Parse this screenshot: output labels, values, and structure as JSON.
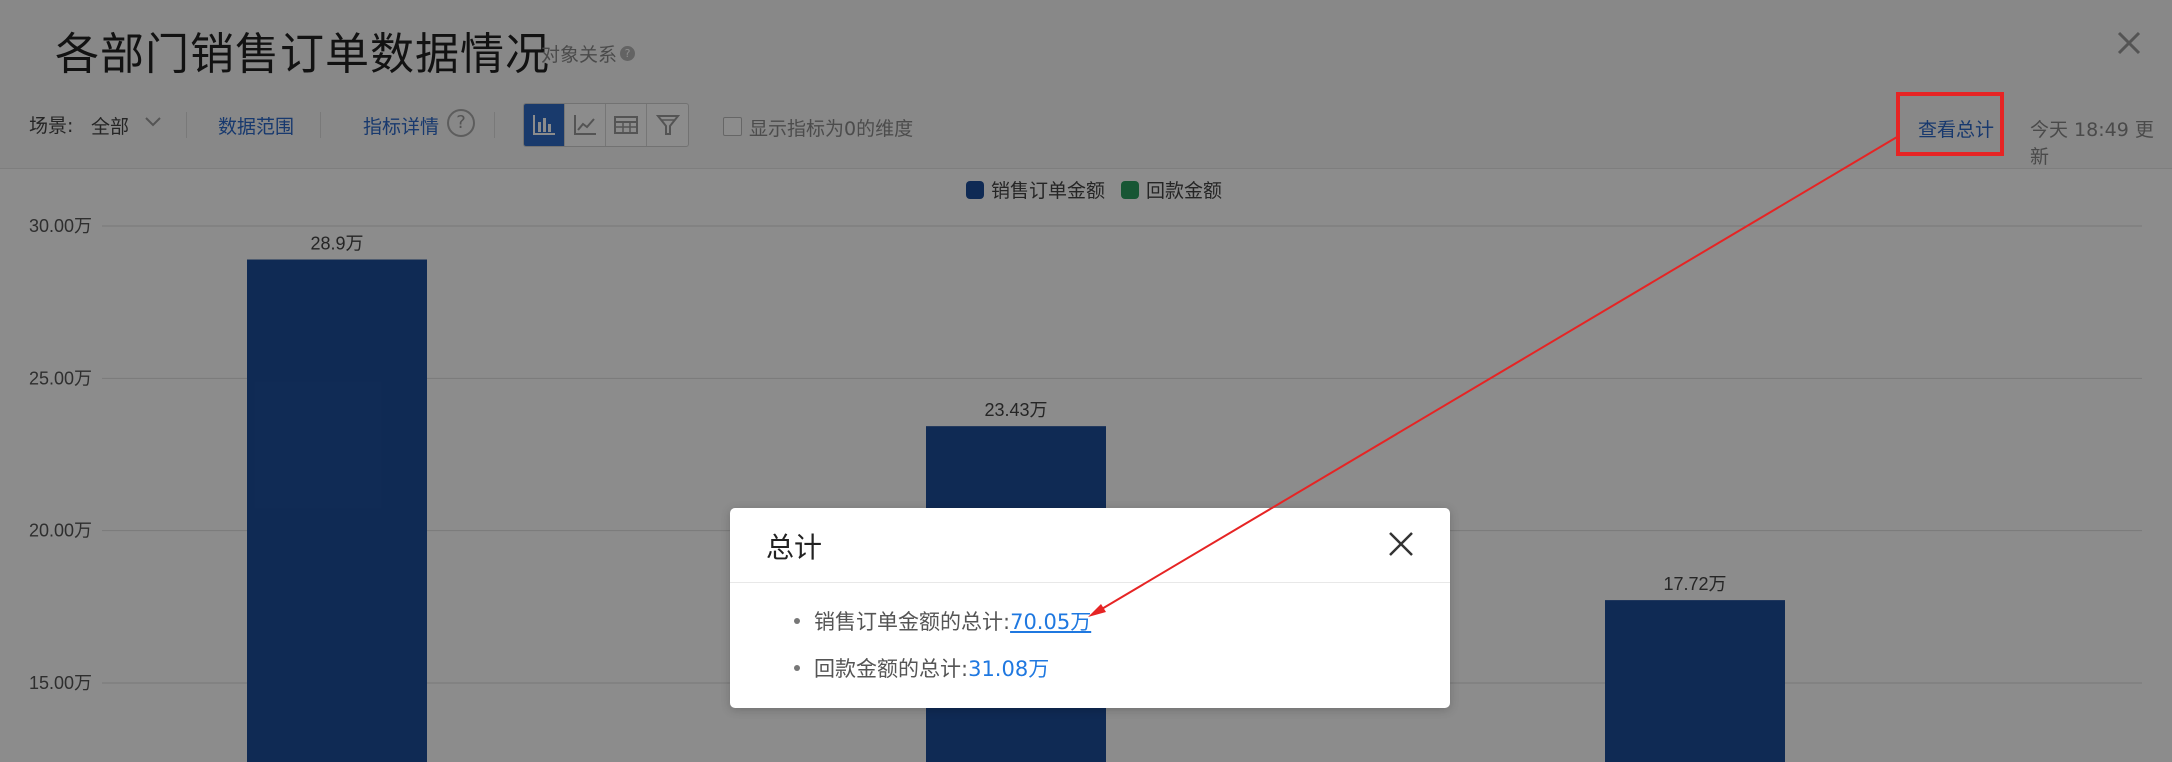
{
  "header": {
    "title": "各部门销售订单数据情况",
    "relation_label": "对象关系"
  },
  "toolbar": {
    "scene_label": "场景:",
    "scene_value": "全部",
    "data_range": "数据范围",
    "indicator_detail": "指标详情",
    "help_glyph": "?",
    "show_zero_label": "显示指标为0的维度",
    "view_total": "查看总计",
    "updated": "今天 18:49 更新"
  },
  "chart_data": {
    "type": "bar",
    "series": [
      {
        "name": "销售订单金额",
        "color": "#1d4e9a",
        "values": [
          28.9,
          23.43,
          17.72
        ],
        "labels": [
          "28.9万",
          "23.43万",
          "17.72万"
        ]
      },
      {
        "name": "回款金额",
        "color": "#2a9d5f"
      }
    ],
    "y_ticks": [
      "30.00万",
      "25.00万",
      "20.00万",
      "15.00万"
    ],
    "y_tick_values": [
      30,
      25,
      20,
      15
    ],
    "grid": true,
    "legend": "top-center"
  },
  "modal": {
    "title": "总计",
    "items": [
      {
        "label": "销售订单金额的总计:",
        "value": "70.05万"
      },
      {
        "label": "回款金额的总计:",
        "value": "31.08万"
      }
    ]
  },
  "colors": {
    "accent": "#2c69c9",
    "highlight": "#e62424",
    "bar": "#1d4e9a",
    "legend_green": "#2a9d5f"
  }
}
